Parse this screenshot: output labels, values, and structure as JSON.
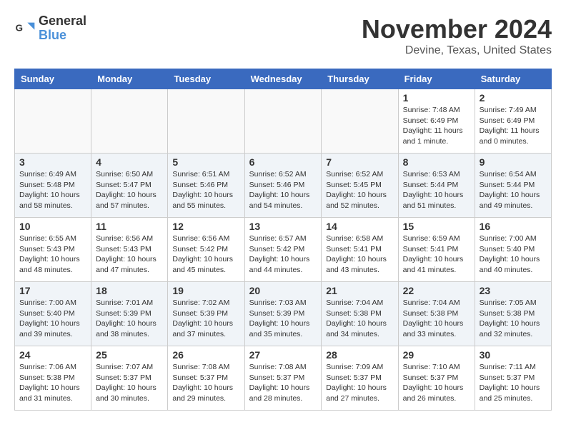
{
  "header": {
    "logo_line1": "General",
    "logo_line2": "Blue",
    "month": "November 2024",
    "location": "Devine, Texas, United States"
  },
  "weekdays": [
    "Sunday",
    "Monday",
    "Tuesday",
    "Wednesday",
    "Thursday",
    "Friday",
    "Saturday"
  ],
  "weeks": [
    [
      {
        "day": "",
        "info": ""
      },
      {
        "day": "",
        "info": ""
      },
      {
        "day": "",
        "info": ""
      },
      {
        "day": "",
        "info": ""
      },
      {
        "day": "",
        "info": ""
      },
      {
        "day": "1",
        "info": "Sunrise: 7:48 AM\nSunset: 6:49 PM\nDaylight: 11 hours\nand 1 minute."
      },
      {
        "day": "2",
        "info": "Sunrise: 7:49 AM\nSunset: 6:49 PM\nDaylight: 11 hours\nand 0 minutes."
      }
    ],
    [
      {
        "day": "3",
        "info": "Sunrise: 6:49 AM\nSunset: 5:48 PM\nDaylight: 10 hours\nand 58 minutes."
      },
      {
        "day": "4",
        "info": "Sunrise: 6:50 AM\nSunset: 5:47 PM\nDaylight: 10 hours\nand 57 minutes."
      },
      {
        "day": "5",
        "info": "Sunrise: 6:51 AM\nSunset: 5:46 PM\nDaylight: 10 hours\nand 55 minutes."
      },
      {
        "day": "6",
        "info": "Sunrise: 6:52 AM\nSunset: 5:46 PM\nDaylight: 10 hours\nand 54 minutes."
      },
      {
        "day": "7",
        "info": "Sunrise: 6:52 AM\nSunset: 5:45 PM\nDaylight: 10 hours\nand 52 minutes."
      },
      {
        "day": "8",
        "info": "Sunrise: 6:53 AM\nSunset: 5:44 PM\nDaylight: 10 hours\nand 51 minutes."
      },
      {
        "day": "9",
        "info": "Sunrise: 6:54 AM\nSunset: 5:44 PM\nDaylight: 10 hours\nand 49 minutes."
      }
    ],
    [
      {
        "day": "10",
        "info": "Sunrise: 6:55 AM\nSunset: 5:43 PM\nDaylight: 10 hours\nand 48 minutes."
      },
      {
        "day": "11",
        "info": "Sunrise: 6:56 AM\nSunset: 5:43 PM\nDaylight: 10 hours\nand 47 minutes."
      },
      {
        "day": "12",
        "info": "Sunrise: 6:56 AM\nSunset: 5:42 PM\nDaylight: 10 hours\nand 45 minutes."
      },
      {
        "day": "13",
        "info": "Sunrise: 6:57 AM\nSunset: 5:42 PM\nDaylight: 10 hours\nand 44 minutes."
      },
      {
        "day": "14",
        "info": "Sunrise: 6:58 AM\nSunset: 5:41 PM\nDaylight: 10 hours\nand 43 minutes."
      },
      {
        "day": "15",
        "info": "Sunrise: 6:59 AM\nSunset: 5:41 PM\nDaylight: 10 hours\nand 41 minutes."
      },
      {
        "day": "16",
        "info": "Sunrise: 7:00 AM\nSunset: 5:40 PM\nDaylight: 10 hours\nand 40 minutes."
      }
    ],
    [
      {
        "day": "17",
        "info": "Sunrise: 7:00 AM\nSunset: 5:40 PM\nDaylight: 10 hours\nand 39 minutes."
      },
      {
        "day": "18",
        "info": "Sunrise: 7:01 AM\nSunset: 5:39 PM\nDaylight: 10 hours\nand 38 minutes."
      },
      {
        "day": "19",
        "info": "Sunrise: 7:02 AM\nSunset: 5:39 PM\nDaylight: 10 hours\nand 37 minutes."
      },
      {
        "day": "20",
        "info": "Sunrise: 7:03 AM\nSunset: 5:39 PM\nDaylight: 10 hours\nand 35 minutes."
      },
      {
        "day": "21",
        "info": "Sunrise: 7:04 AM\nSunset: 5:38 PM\nDaylight: 10 hours\nand 34 minutes."
      },
      {
        "day": "22",
        "info": "Sunrise: 7:04 AM\nSunset: 5:38 PM\nDaylight: 10 hours\nand 33 minutes."
      },
      {
        "day": "23",
        "info": "Sunrise: 7:05 AM\nSunset: 5:38 PM\nDaylight: 10 hours\nand 32 minutes."
      }
    ],
    [
      {
        "day": "24",
        "info": "Sunrise: 7:06 AM\nSunset: 5:38 PM\nDaylight: 10 hours\nand 31 minutes."
      },
      {
        "day": "25",
        "info": "Sunrise: 7:07 AM\nSunset: 5:37 PM\nDaylight: 10 hours\nand 30 minutes."
      },
      {
        "day": "26",
        "info": "Sunrise: 7:08 AM\nSunset: 5:37 PM\nDaylight: 10 hours\nand 29 minutes."
      },
      {
        "day": "27",
        "info": "Sunrise: 7:08 AM\nSunset: 5:37 PM\nDaylight: 10 hours\nand 28 minutes."
      },
      {
        "day": "28",
        "info": "Sunrise: 7:09 AM\nSunset: 5:37 PM\nDaylight: 10 hours\nand 27 minutes."
      },
      {
        "day": "29",
        "info": "Sunrise: 7:10 AM\nSunset: 5:37 PM\nDaylight: 10 hours\nand 26 minutes."
      },
      {
        "day": "30",
        "info": "Sunrise: 7:11 AM\nSunset: 5:37 PM\nDaylight: 10 hours\nand 25 minutes."
      }
    ]
  ]
}
